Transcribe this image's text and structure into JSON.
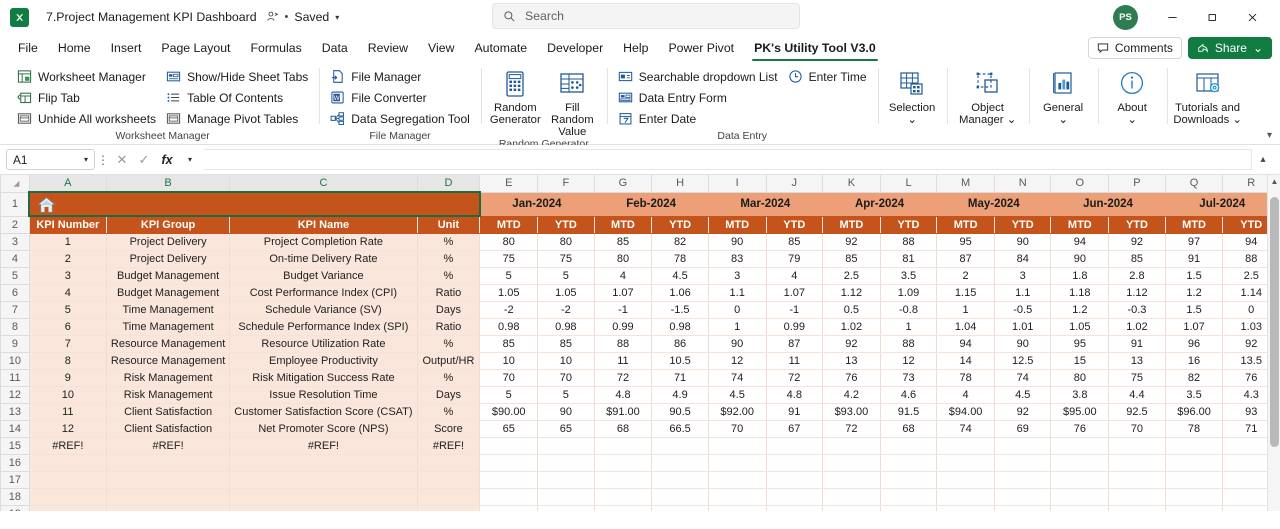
{
  "titlebar": {
    "doc_title": "7.Project Management KPI Dashboard",
    "saved_label": "Saved",
    "dot": "•",
    "person_icon": "person-share-icon",
    "search_placeholder": "Search",
    "avatar_initials": "PS",
    "minimize": "–",
    "restore": "❐",
    "close": "✕"
  },
  "tabs": [
    {
      "label": "File",
      "active": false
    },
    {
      "label": "Home",
      "active": false
    },
    {
      "label": "Insert",
      "active": false
    },
    {
      "label": "Page Layout",
      "active": false
    },
    {
      "label": "Formulas",
      "active": false
    },
    {
      "label": "Data",
      "active": false
    },
    {
      "label": "Review",
      "active": false
    },
    {
      "label": "View",
      "active": false
    },
    {
      "label": "Automate",
      "active": false
    },
    {
      "label": "Developer",
      "active": false
    },
    {
      "label": "Help",
      "active": false
    },
    {
      "label": "Power Pivot",
      "active": false
    },
    {
      "label": "PK's Utility Tool V3.0",
      "active": true
    }
  ],
  "tabs_right": {
    "comments_label": "Comments",
    "share_label": "Share",
    "share_chevron": "⌄"
  },
  "ribbon": {
    "collapse_icon": "chevron-down-icon",
    "groups": [
      {
        "title": "Worksheet Manager",
        "columns": [
          [
            {
              "label": "Worksheet Manager",
              "icon": "worksheet-manager-icon"
            },
            {
              "label": "Flip Tab",
              "icon": "flip-tab-icon"
            },
            {
              "label": "Unhide All worksheets",
              "icon": "unhide-worksheets-icon"
            }
          ],
          [
            {
              "label": "Show/Hide Sheet Tabs",
              "icon": "show-hide-tabs-icon"
            },
            {
              "label": "Table Of Contents",
              "icon": "table-of-contents-icon"
            },
            {
              "label": "Manage Pivot Tables",
              "icon": "manage-pivot-icon"
            }
          ]
        ]
      },
      {
        "title": "File Manager",
        "columns": [
          [
            {
              "label": "File Manager",
              "icon": "file-manager-icon"
            },
            {
              "label": "File Converter",
              "icon": "file-converter-icon"
            },
            {
              "label": "Data Segregation Tool",
              "icon": "data-segregation-icon"
            }
          ]
        ]
      },
      {
        "title": "Random Generator",
        "big": [
          {
            "line1": "Random",
            "line2": "Generator",
            "icon": "random-generator-icon"
          },
          {
            "line1": "Fill Random",
            "line2": "Value",
            "icon": "fill-random-value-icon"
          }
        ]
      },
      {
        "title": "Data Entry",
        "columns": [
          [
            {
              "label": "Searchable dropdown List",
              "icon": "searchable-dropdown-icon"
            },
            {
              "label": "Data Entry Form",
              "icon": "data-entry-form-icon"
            },
            {
              "label": "Enter Date",
              "icon": "enter-date-icon"
            }
          ],
          [
            {
              "label": "Enter Time",
              "icon": "enter-time-icon"
            }
          ]
        ]
      },
      {
        "title": "",
        "big": [
          {
            "line1": "Selection",
            "line2": "⌄",
            "icon": "selection-icon"
          }
        ]
      },
      {
        "title": "",
        "big": [
          {
            "line1": "Object",
            "line2": "Manager ⌄",
            "icon": "object-manager-icon"
          }
        ]
      },
      {
        "title": "",
        "big": [
          {
            "line1": "General",
            "line2": "⌄",
            "icon": "general-icon"
          }
        ]
      },
      {
        "title": "",
        "big": [
          {
            "line1": "About",
            "line2": "⌄",
            "icon": "about-icon"
          }
        ]
      },
      {
        "title": "",
        "big": [
          {
            "line1": "Tutorials and",
            "line2": "Downloads ⌄",
            "icon": "tutorials-downloads-icon"
          }
        ]
      }
    ]
  },
  "formula_bar": {
    "name_box_value": "A1",
    "name_box_chevron": "⌄",
    "more_icon": "kebab-icon",
    "cancel_icon": "✕",
    "confirm_icon": "✓",
    "fx_label": "fx",
    "fx_chevron": "⌄",
    "formula_value": "",
    "expand_icon": "chevron-up-icon"
  },
  "sheet": {
    "column_letters": [
      "A",
      "B",
      "C",
      "D",
      "E",
      "F",
      "G",
      "H",
      "I",
      "J",
      "K",
      "L",
      "M",
      "N",
      "O",
      "P",
      "Q",
      "R"
    ],
    "selected_columns": [
      "A",
      "B",
      "C",
      "D"
    ],
    "row_numbers": [
      "1",
      "2",
      "3",
      "4",
      "5",
      "6",
      "7",
      "8",
      "9",
      "10",
      "11",
      "12",
      "13",
      "14",
      "15",
      "16",
      "17",
      "18",
      "19"
    ],
    "banner_icon": "home-icon",
    "months": [
      "Jan-2024",
      "Feb-2024",
      "Mar-2024",
      "Apr-2024",
      "May-2024",
      "Jun-2024",
      "Jul-2024"
    ],
    "sub_headers": [
      "MTD",
      "YTD"
    ],
    "left_headers": [
      "KPI Number",
      "KPI Group",
      "KPI Name",
      "Unit"
    ],
    "rows": [
      {
        "num": "1",
        "group": "Project Delivery",
        "name": "Project Completion Rate",
        "unit": "%",
        "values": [
          "80",
          "80",
          "85",
          "82",
          "90",
          "85",
          "92",
          "88",
          "95",
          "90",
          "94",
          "92",
          "97",
          "94"
        ]
      },
      {
        "num": "2",
        "group": "Project Delivery",
        "name": "On-time Delivery Rate",
        "unit": "%",
        "values": [
          "75",
          "75",
          "80",
          "78",
          "83",
          "79",
          "85",
          "81",
          "87",
          "84",
          "90",
          "85",
          "91",
          "88"
        ]
      },
      {
        "num": "3",
        "group": "Budget Management",
        "name": "Budget Variance",
        "unit": "%",
        "values": [
          "5",
          "5",
          "4",
          "4.5",
          "3",
          "4",
          "2.5",
          "3.5",
          "2",
          "3",
          "1.8",
          "2.8",
          "1.5",
          "2.5"
        ]
      },
      {
        "num": "4",
        "group": "Budget Management",
        "name": "Cost Performance Index (CPI)",
        "unit": "Ratio",
        "values": [
          "1.05",
          "1.05",
          "1.07",
          "1.06",
          "1.1",
          "1.07",
          "1.12",
          "1.09",
          "1.15",
          "1.1",
          "1.18",
          "1.12",
          "1.2",
          "1.14"
        ]
      },
      {
        "num": "5",
        "group": "Time Management",
        "name": "Schedule Variance (SV)",
        "unit": "Days",
        "values": [
          "-2",
          "-2",
          "-1",
          "-1.5",
          "0",
          "-1",
          "0.5",
          "-0.8",
          "1",
          "-0.5",
          "1.2",
          "-0.3",
          "1.5",
          "0"
        ]
      },
      {
        "num": "6",
        "group": "Time Management",
        "name": "Schedule Performance Index (SPI)",
        "unit": "Ratio",
        "values": [
          "0.98",
          "0.98",
          "0.99",
          "0.98",
          "1",
          "0.99",
          "1.02",
          "1",
          "1.04",
          "1.01",
          "1.05",
          "1.02",
          "1.07",
          "1.03"
        ]
      },
      {
        "num": "7",
        "group": "Resource Management",
        "name": "Resource Utilization Rate",
        "unit": "%",
        "values": [
          "85",
          "85",
          "88",
          "86",
          "90",
          "87",
          "92",
          "88",
          "94",
          "90",
          "95",
          "91",
          "96",
          "92"
        ]
      },
      {
        "num": "8",
        "group": "Resource Management",
        "name": "Employee Productivity",
        "unit": "Output/HR",
        "values": [
          "10",
          "10",
          "11",
          "10.5",
          "12",
          "11",
          "13",
          "12",
          "14",
          "12.5",
          "15",
          "13",
          "16",
          "13.5"
        ]
      },
      {
        "num": "9",
        "group": "Risk Management",
        "name": "Risk Mitigation Success Rate",
        "unit": "%",
        "values": [
          "70",
          "70",
          "72",
          "71",
          "74",
          "72",
          "76",
          "73",
          "78",
          "74",
          "80",
          "75",
          "82",
          "76"
        ]
      },
      {
        "num": "10",
        "group": "Risk Management",
        "name": "Issue Resolution Time",
        "unit": "Days",
        "values": [
          "5",
          "5",
          "4.8",
          "4.9",
          "4.5",
          "4.8",
          "4.2",
          "4.6",
          "4",
          "4.5",
          "3.8",
          "4.4",
          "3.5",
          "4.3"
        ]
      },
      {
        "num": "11",
        "group": "Client Satisfaction",
        "name": "Customer Satisfaction Score (CSAT)",
        "unit": "%",
        "values": [
          "$90.00",
          "90",
          "$91.00",
          "90.5",
          "$92.00",
          "91",
          "$93.00",
          "91.5",
          "$94.00",
          "92",
          "$95.00",
          "92.5",
          "$96.00",
          "93"
        ]
      },
      {
        "num": "12",
        "group": "Client Satisfaction",
        "name": "Net Promoter Score (NPS)",
        "unit": "Score",
        "values": [
          "65",
          "65",
          "68",
          "66.5",
          "70",
          "67",
          "72",
          "68",
          "74",
          "69",
          "76",
          "70",
          "78",
          "71"
        ]
      },
      {
        "num": "#REF!",
        "group": "#REF!",
        "name": "#REF!",
        "unit": "#REF!",
        "values": [
          "",
          "",
          "",
          "",
          "",
          "",
          "",
          "",
          "",
          "",
          "",
          "",
          "",
          ""
        ]
      },
      {
        "num": "",
        "group": "",
        "name": "",
        "unit": "",
        "values": [
          "",
          "",
          "",
          "",
          "",
          "",
          "",
          "",
          "",
          "",
          "",
          "",
          "",
          ""
        ]
      },
      {
        "num": "",
        "group": "",
        "name": "",
        "unit": "",
        "values": [
          "",
          "",
          "",
          "",
          "",
          "",
          "",
          "",
          "",
          "",
          "",
          "",
          "",
          ""
        ]
      },
      {
        "num": "",
        "group": "",
        "name": "",
        "unit": "",
        "values": [
          "",
          "",
          "",
          "",
          "",
          "",
          "",
          "",
          "",
          "",
          "",
          "",
          "",
          ""
        ]
      },
      {
        "num": "",
        "group": "",
        "name": "",
        "unit": "",
        "values": [
          "",
          "",
          "",
          "",
          "",
          "",
          "",
          "",
          "",
          "",
          "",
          "",
          "",
          ""
        ]
      }
    ]
  },
  "colors": {
    "excel_green": "#107c41",
    "header_orange": "#c4541c",
    "month_orange": "#eda077",
    "row_peach": "#fbe6dc"
  }
}
